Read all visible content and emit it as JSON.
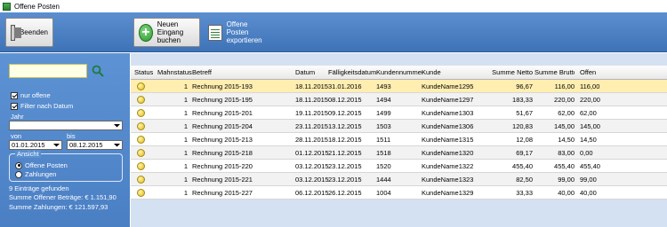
{
  "window": {
    "title": "Offene Posten"
  },
  "toolbar": {
    "exit_label": "Beenden",
    "new_entry_label_1": "Neuen Eingang",
    "new_entry_label_2": "buchen",
    "export_label_1": "Offene Posten",
    "export_label_2": "exportieren"
  },
  "sidebar": {
    "search_value": "",
    "only_open_label": "nur offene",
    "only_open_checked": true,
    "filter_date_label": "Filter nach Datum",
    "filter_date_checked": true,
    "year_label": "Jahr",
    "year_value": "",
    "from_label": "von",
    "from_value": "01.01.2015",
    "to_label": "bis",
    "to_value": "08.12.2015",
    "view_label": "Ansicht",
    "view_options": [
      "Offene Posten",
      "Zahlungen"
    ],
    "view_selected": "Offene Posten",
    "entries_found": "9 Einträge gefunden",
    "sum_open": "Summe Offener Beträge: € 1.151,90",
    "sum_payments": "Summe Zahlungen: € 121.597,93"
  },
  "table": {
    "headers": [
      "Status",
      "Mahnstatus",
      "Betreff",
      "Datum",
      "Fälligkeitsdatum",
      "Kundennummer",
      "Kunde",
      "Summe Netto",
      "Summe Brutto",
      "Offen"
    ],
    "rows": [
      [
        "",
        "1",
        "Rechnung 2015-193",
        "18.11.2015",
        "31.01.2016",
        "1493",
        "KundeName1295",
        "96,67",
        "116,00",
        "116,00"
      ],
      [
        "",
        "1",
        "Rechnung 2015-195",
        "18.11.2015",
        "08.12.2015",
        "1494",
        "KundeName1297",
        "183,33",
        "220,00",
        "220,00"
      ],
      [
        "",
        "1",
        "Rechnung 2015-201",
        "19.11.2015",
        "09.12.2015",
        "1499",
        "KundeName1303",
        "51,67",
        "62,00",
        "62,00"
      ],
      [
        "",
        "1",
        "Rechnung 2015-204",
        "23.11.2015",
        "13.12.2015",
        "1503",
        "KundeName1306",
        "120,83",
        "145,00",
        "145,00"
      ],
      [
        "",
        "1",
        "Rechnung 2015-213",
        "28.11.2015",
        "18.12.2015",
        "1511",
        "KundeName1315",
        "12,08",
        "14,50",
        "14,50"
      ],
      [
        "",
        "1",
        "Rechnung 2015-218",
        "01.12.2015",
        "21.12.2015",
        "1518",
        "KundeName1320",
        "69,17",
        "83,00",
        "0,00"
      ],
      [
        "",
        "1",
        "Rechnung 2015-220",
        "03.12.2015",
        "23.12.2015",
        "1520",
        "KundeName1322",
        "455,40",
        "455,40",
        "455,40"
      ],
      [
        "",
        "1",
        "Rechnung 2015-221",
        "03.12.2015",
        "23.12.2015",
        "1444",
        "KundeName1323",
        "82,50",
        "99,00",
        "99,00"
      ],
      [
        "",
        "1",
        "Rechnung 2015-227",
        "06.12.2015",
        "26.12.2015",
        "1004",
        "KundeName1329",
        "33,33",
        "40,00",
        "40,00"
      ]
    ],
    "selected_row": 0,
    "status_color": "#e6c22a",
    "selected_color": "#ffeeb0"
  }
}
